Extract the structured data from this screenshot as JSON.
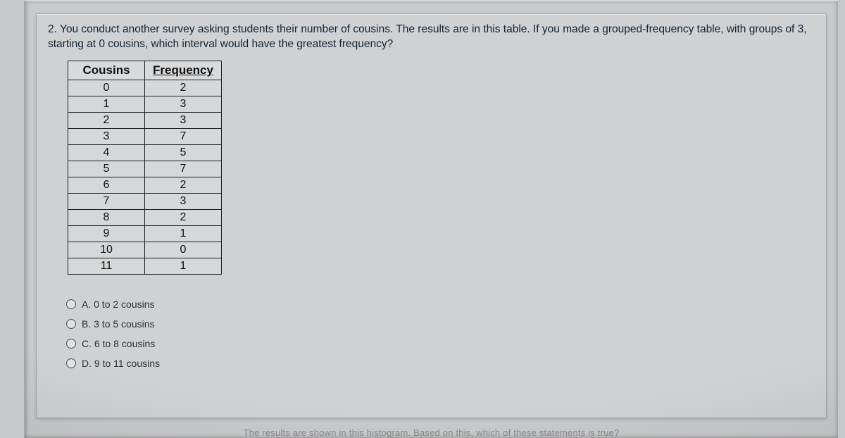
{
  "question": {
    "text": "2. You conduct another survey asking students their number of cousins. The results are in this table. If you made a grouped-frequency table, with groups of 3, starting at 0 cousins, which interval would have the greatest frequency?"
  },
  "table": {
    "headers": [
      "Cousins",
      "Frequency"
    ],
    "rows": [
      [
        "0",
        "2"
      ],
      [
        "1",
        "3"
      ],
      [
        "2",
        "3"
      ],
      [
        "3",
        "7"
      ],
      [
        "4",
        "5"
      ],
      [
        "5",
        "7"
      ],
      [
        "6",
        "2"
      ],
      [
        "7",
        "3"
      ],
      [
        "8",
        "2"
      ],
      [
        "9",
        "1"
      ],
      [
        "10",
        "0"
      ],
      [
        "11",
        "1"
      ]
    ]
  },
  "choices": [
    {
      "letter": "A.",
      "label": "0 to 2 cousins"
    },
    {
      "letter": "B.",
      "label": "3 to 5 cousins"
    },
    {
      "letter": "C.",
      "label": "6 to 8 cousins"
    },
    {
      "letter": "D.",
      "label": "9 to 11 cousins"
    }
  ],
  "footer_fragment": "The results are shown in this histogram. Based on this, which of these statements is true?"
}
